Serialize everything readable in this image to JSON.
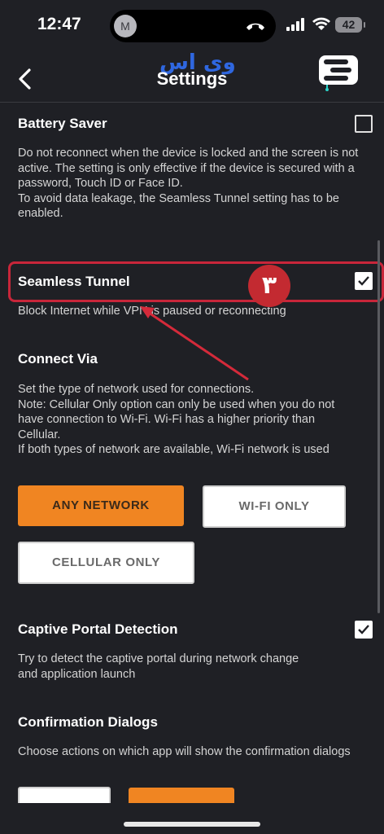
{
  "status_bar": {
    "time": "12:47",
    "avatar_letter": "M",
    "battery": "42"
  },
  "header": {
    "title": "Settings",
    "watermark": "وی اس"
  },
  "settings": {
    "battery_saver": {
      "title": "Battery Saver",
      "description": "Do not reconnect when the device is locked and the screen is not active. The setting is only effective if the device is secured with a password, Touch ID or Face ID.\nTo avoid data leakage, the Seamless Tunnel setting has to be enabled.",
      "checked": false
    },
    "seamless_tunnel": {
      "title": "Seamless Tunnel",
      "description": "Block Internet while VPN is paused or reconnecting",
      "checked": true
    },
    "connect_via": {
      "title": "Connect Via",
      "description": "Set the type of network used for connections.\nNote: Cellular Only option can only be used when you do not have connection to Wi-Fi. Wi-Fi has a higher priority than Cellular.\nIf both types of network are available, Wi-Fi network is used",
      "options": [
        "ANY NETWORK",
        "WI-FI ONLY",
        "CELLULAR ONLY"
      ],
      "selected": "ANY NETWORK"
    },
    "captive_portal": {
      "title": "Captive Portal Detection",
      "description": "Try to detect the captive portal during network change and application launch",
      "checked": true
    },
    "confirmation_dialogs": {
      "title": "Confirmation Dialogs",
      "description": "Choose actions on which app will show the confirmation dialogs"
    }
  },
  "annotation": {
    "step_number": "۳",
    "color": "#c32a31"
  },
  "colors": {
    "background": "#1f2025",
    "accent": "#f08522",
    "highlight": "#c8263a"
  }
}
